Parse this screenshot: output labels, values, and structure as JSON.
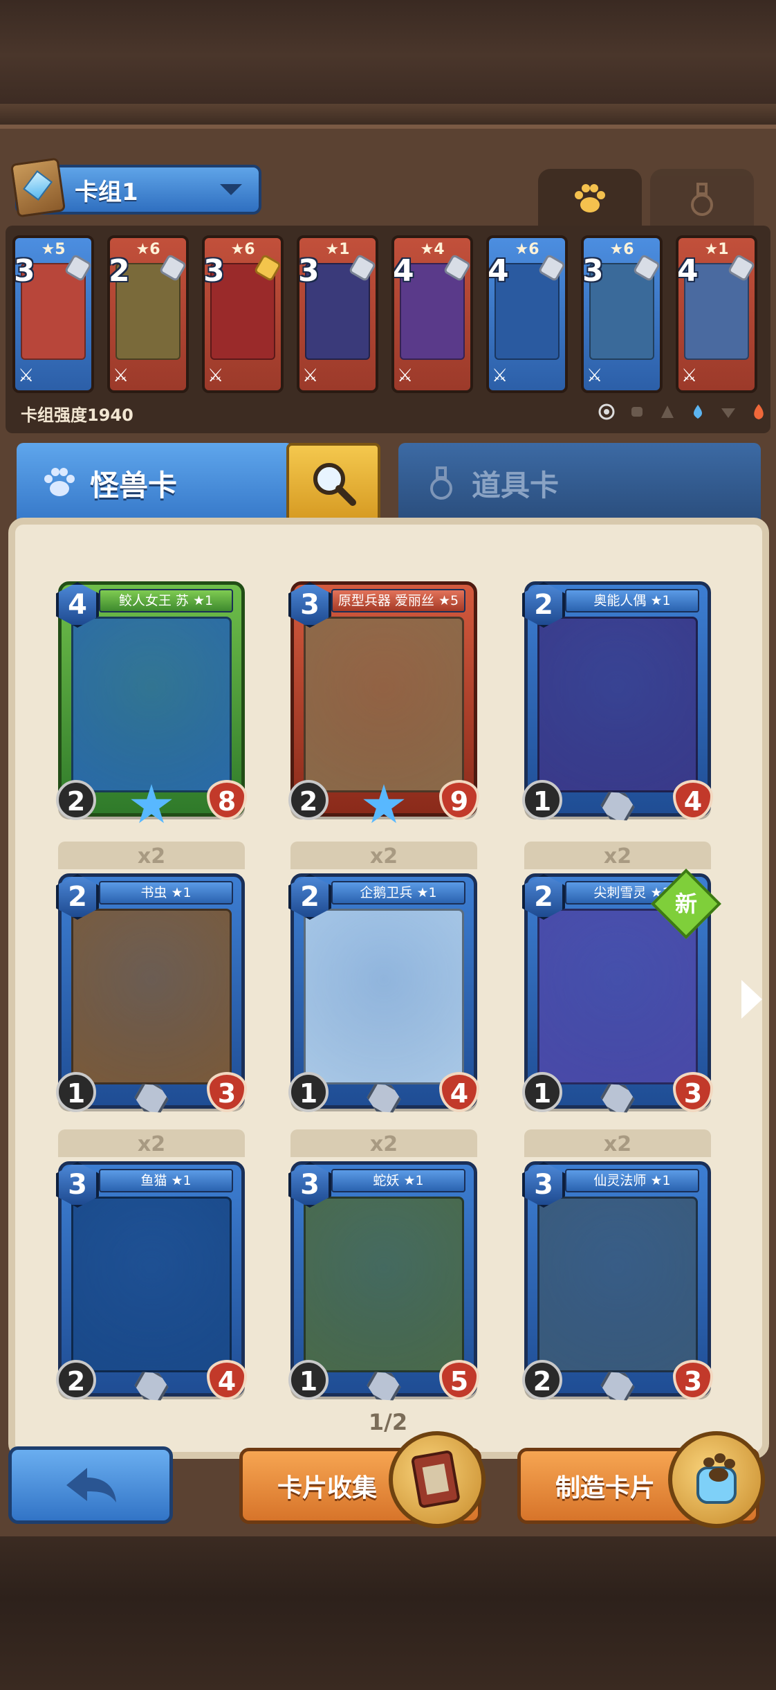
{
  "deck_bar": {
    "deck_name": "卡组1",
    "deck_power": "卡组强度1940"
  },
  "top_tabs": [
    {
      "icon": "paw-icon",
      "active": true
    },
    {
      "icon": "potion-icon",
      "active": false
    }
  ],
  "deck_cards": [
    {
      "cost": "3",
      "stars": "★5",
      "frame": "blue",
      "art_color": "#b8463a",
      "gem": "blue-gem"
    },
    {
      "cost": "2",
      "stars": "★6",
      "frame": "red",
      "art_color": "#7a6a3a",
      "gem": "silver-gem"
    },
    {
      "cost": "3",
      "stars": "★6",
      "frame": "red",
      "art_color": "#9a2a2a",
      "gem": "gold-gem"
    },
    {
      "cost": "3",
      "stars": "★1",
      "frame": "red",
      "art_color": "#3a3a7a",
      "gem": "silver-gem"
    },
    {
      "cost": "4",
      "stars": "★4",
      "frame": "red",
      "art_color": "#5a3a8a",
      "gem": "silver-gem"
    },
    {
      "cost": "4",
      "stars": "★6",
      "frame": "blue",
      "art_color": "#2a5aa0",
      "gem": "silver-gem"
    },
    {
      "cost": "3",
      "stars": "★6",
      "frame": "blue",
      "art_color": "#3a6a9a",
      "gem": "silver-gem"
    },
    {
      "cost": "4",
      "stars": "★1",
      "frame": "red",
      "art_color": "#4a6aa0",
      "gem": "silver-gem"
    }
  ],
  "filters": [
    "all-filter-icon",
    "fist-icon",
    "claw-icon",
    "water-drop-icon",
    "wing-icon",
    "fire-icon"
  ],
  "category_tabs": {
    "monster": "怪兽卡",
    "item": "道具卡"
  },
  "cards": [
    {
      "name": "鲛人女王 苏 ★1",
      "cost": "4",
      "atk": "2",
      "hp": "8",
      "frame": "green",
      "art": "#2a6aa8",
      "rarity": "star",
      "count": ""
    },
    {
      "name": "原型兵器 爱丽丝 ★5",
      "cost": "3",
      "atk": "2",
      "hp": "9",
      "frame": "red",
      "art": "#8a6a4a",
      "rarity": "star",
      "count": ""
    },
    {
      "name": "奥能人偶 ★1",
      "cost": "2",
      "atk": "1",
      "hp": "4",
      "frame": "blue",
      "art": "#3a3a8a",
      "rarity": "gem",
      "count": ""
    },
    {
      "name": "书虫 ★1",
      "cost": "2",
      "atk": "1",
      "hp": "3",
      "frame": "blue",
      "art": "#7a5a3a",
      "rarity": "gem",
      "count": "x2"
    },
    {
      "name": "企鹅卫兵 ★1",
      "cost": "2",
      "atk": "1",
      "hp": "4",
      "frame": "blue",
      "art": "#a9c8e6",
      "rarity": "gem",
      "count": "x2"
    },
    {
      "name": "尖刺雪灵 ★1",
      "cost": "2",
      "atk": "1",
      "hp": "3",
      "frame": "blue",
      "art": "#4a4aa8",
      "rarity": "gem",
      "count": "x2"
    },
    {
      "name": "鱼猫 ★1",
      "cost": "3",
      "atk": "2",
      "hp": "4",
      "frame": "blue",
      "art": "#1a4a8a",
      "rarity": "gem",
      "count": "x2"
    },
    {
      "name": "蛇妖 ★1",
      "cost": "3",
      "atk": "1",
      "hp": "5",
      "frame": "blue",
      "art": "#4a6a4a",
      "rarity": "gem",
      "count": "x2"
    },
    {
      "name": "仙灵法师 ★1",
      "cost": "3",
      "atk": "2",
      "hp": "3",
      "frame": "blue",
      "art": "#3a5a7a",
      "rarity": "gem",
      "count": "x2"
    }
  ],
  "new_badge": "新",
  "page_indicator": "1/2",
  "buttons": {
    "collect": "卡片收集",
    "craft": "制造卡片"
  }
}
